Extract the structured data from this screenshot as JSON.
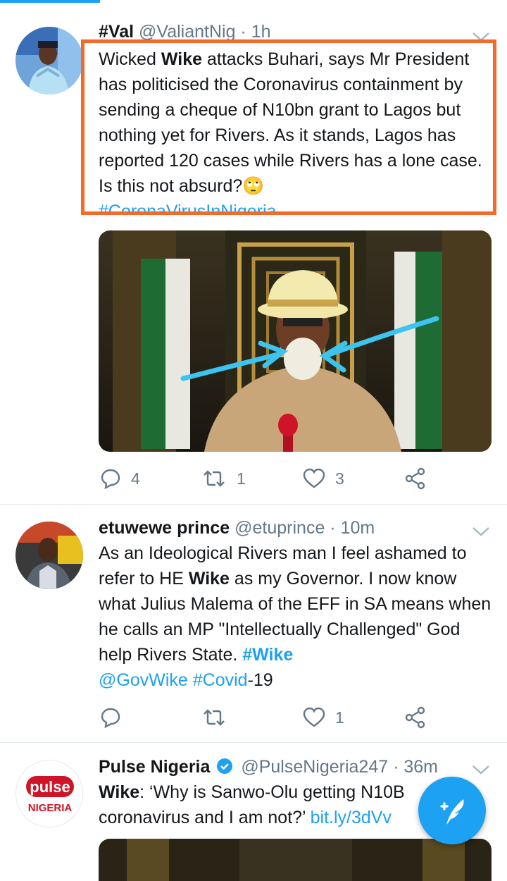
{
  "tweets": [
    {
      "name": "#Val",
      "handle": "@ValiantNig · 1h",
      "body_parts": [
        "Wicked ",
        "Wike",
        " attacks Buhari, says Mr President has politicised the Coronavirus containment by sending a cheque of N10bn grant to Lagos but nothing yet for Rivers. As it stands, Lagos has reported 120 cases while Rivers has a lone case. Is this not absurd?"
      ],
      "emoji": "🙄",
      "hashtag": "#CoronaVirusInNigeria",
      "reply_count": "4",
      "retweet_count": "1",
      "like_count": "3"
    },
    {
      "name": "etuwewe prince",
      "handle": "@etuprince · 10m",
      "body_parts": [
        "As an Ideological Rivers man I feel ashamed to refer to HE  ",
        "Wike",
        " as my Governor. I now know what Julius Malema of the EFF in SA means when he calls an MP \"Intellectually Challenged\" God help Rivers State. "
      ],
      "tags": [
        "#Wike",
        "@GovWike",
        "#Covid"
      ],
      "tail": "-19",
      "like_count": "1"
    },
    {
      "name": "Pulse Nigeria",
      "handle": "@PulseNigeria247 · 36m",
      "line1_bold": "Wike",
      "line1_rest": ": ‘Why is Sanwo-Olu getting N10B",
      "line2_text": "coronavirus and I am not?’ ",
      "line2_link": "bit.ly/3dVv",
      "avatar_text_top": "pulse",
      "avatar_text_bottom": "NIGERIA"
    }
  ],
  "colors": {
    "accent": "#1da1f2",
    "highlight_box": "#f36a2a",
    "secondary_text": "#657786"
  },
  "icons": [
    "reply-icon",
    "retweet-icon",
    "like-icon",
    "share-icon",
    "chevron-down-icon",
    "verified-badge-icon",
    "compose-icon"
  ]
}
